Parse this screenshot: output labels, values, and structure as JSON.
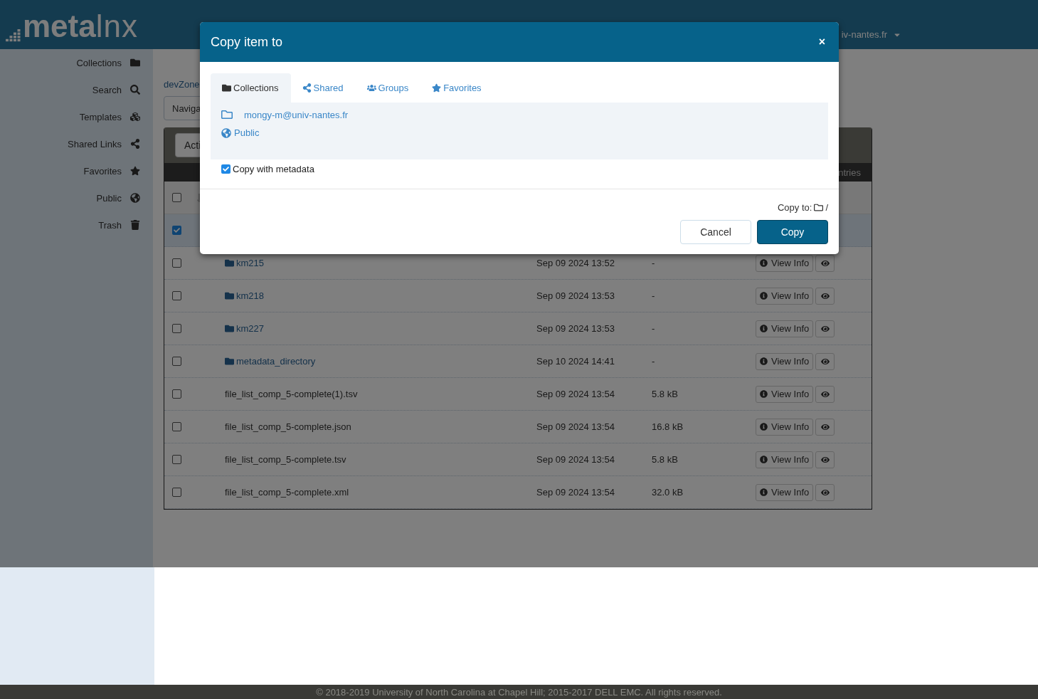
{
  "header": {
    "logo_bold": "meta",
    "logo_light": "lnx",
    "user": "iv-nantes.fr"
  },
  "sidebar": {
    "items": [
      {
        "label": "Collections"
      },
      {
        "label": "Search"
      },
      {
        "label": "Templates"
      },
      {
        "label": "Shared Links"
      },
      {
        "label": "Favorites"
      },
      {
        "label": "Public"
      },
      {
        "label": "Trash"
      }
    ]
  },
  "breadcrumb": "devZone",
  "navigation": "Naviga",
  "table": {
    "action_button": "Acti",
    "entries_label": "ntries",
    "select_all": {
      "checked": false
    },
    "rows": [
      {
        "kind": "hidden",
        "checked": true,
        "selected": true
      },
      {
        "kind": "folder",
        "name": "km215",
        "date": "Sep 09 2024 13:52",
        "size": "-",
        "action": "View Info",
        "checked": false,
        "selected": false
      },
      {
        "kind": "folder",
        "name": "km218",
        "date": "Sep 09 2024 13:53",
        "size": "-",
        "action": "View Info",
        "checked": false,
        "selected": false
      },
      {
        "kind": "folder",
        "name": "km227",
        "date": "Sep 09 2024 13:53",
        "size": "-",
        "action": "View Info",
        "checked": false,
        "selected": false
      },
      {
        "kind": "folder",
        "name": "metadata_directory",
        "date": "Sep 10 2024 14:41",
        "size": "-",
        "action": "View Info",
        "checked": false,
        "selected": false
      },
      {
        "kind": "file",
        "name": "file_list_comp_5-complete(1).tsv",
        "date": "Sep 09 2024 13:54",
        "size": "5.8 kB",
        "action": "View Info",
        "checked": false,
        "selected": false
      },
      {
        "kind": "file",
        "name": "file_list_comp_5-complete.json",
        "date": "Sep 09 2024 13:54",
        "size": "16.8 kB",
        "action": "View Info",
        "checked": false,
        "selected": false
      },
      {
        "kind": "file",
        "name": "file_list_comp_5-complete.tsv",
        "date": "Sep 09 2024 13:54",
        "size": "5.8 kB",
        "action": "View Info",
        "checked": false,
        "selected": false
      },
      {
        "kind": "file",
        "name": "file_list_comp_5-complete.xml",
        "date": "Sep 09 2024 13:54",
        "size": "32.0 kB",
        "action": "View Info",
        "checked": false,
        "selected": false
      }
    ]
  },
  "modal": {
    "title": "Copy item to",
    "close": "×",
    "tabs": [
      {
        "label": "Collections",
        "selected": true
      },
      {
        "label": "Shared",
        "selected": false
      },
      {
        "label": "Groups",
        "selected": false
      },
      {
        "label": "Favorites",
        "selected": false
      }
    ],
    "destinations": [
      {
        "label": "mongy-m@univ-nantes.fr"
      },
      {
        "label": "Public"
      }
    ],
    "metadata": {
      "label": "Copy with metadata",
      "checked": true
    },
    "copy_to_label": "Copy to:",
    "copy_to_path": "/",
    "buttons": [
      {
        "label": "Cancel",
        "kind": "secondary"
      },
      {
        "label": "Copy",
        "kind": "primary"
      }
    ]
  },
  "footer": "© 2018-2019 University of North Carolina at Chapel Hill; 2015-2017 DELL EMC. All rights reserved."
}
